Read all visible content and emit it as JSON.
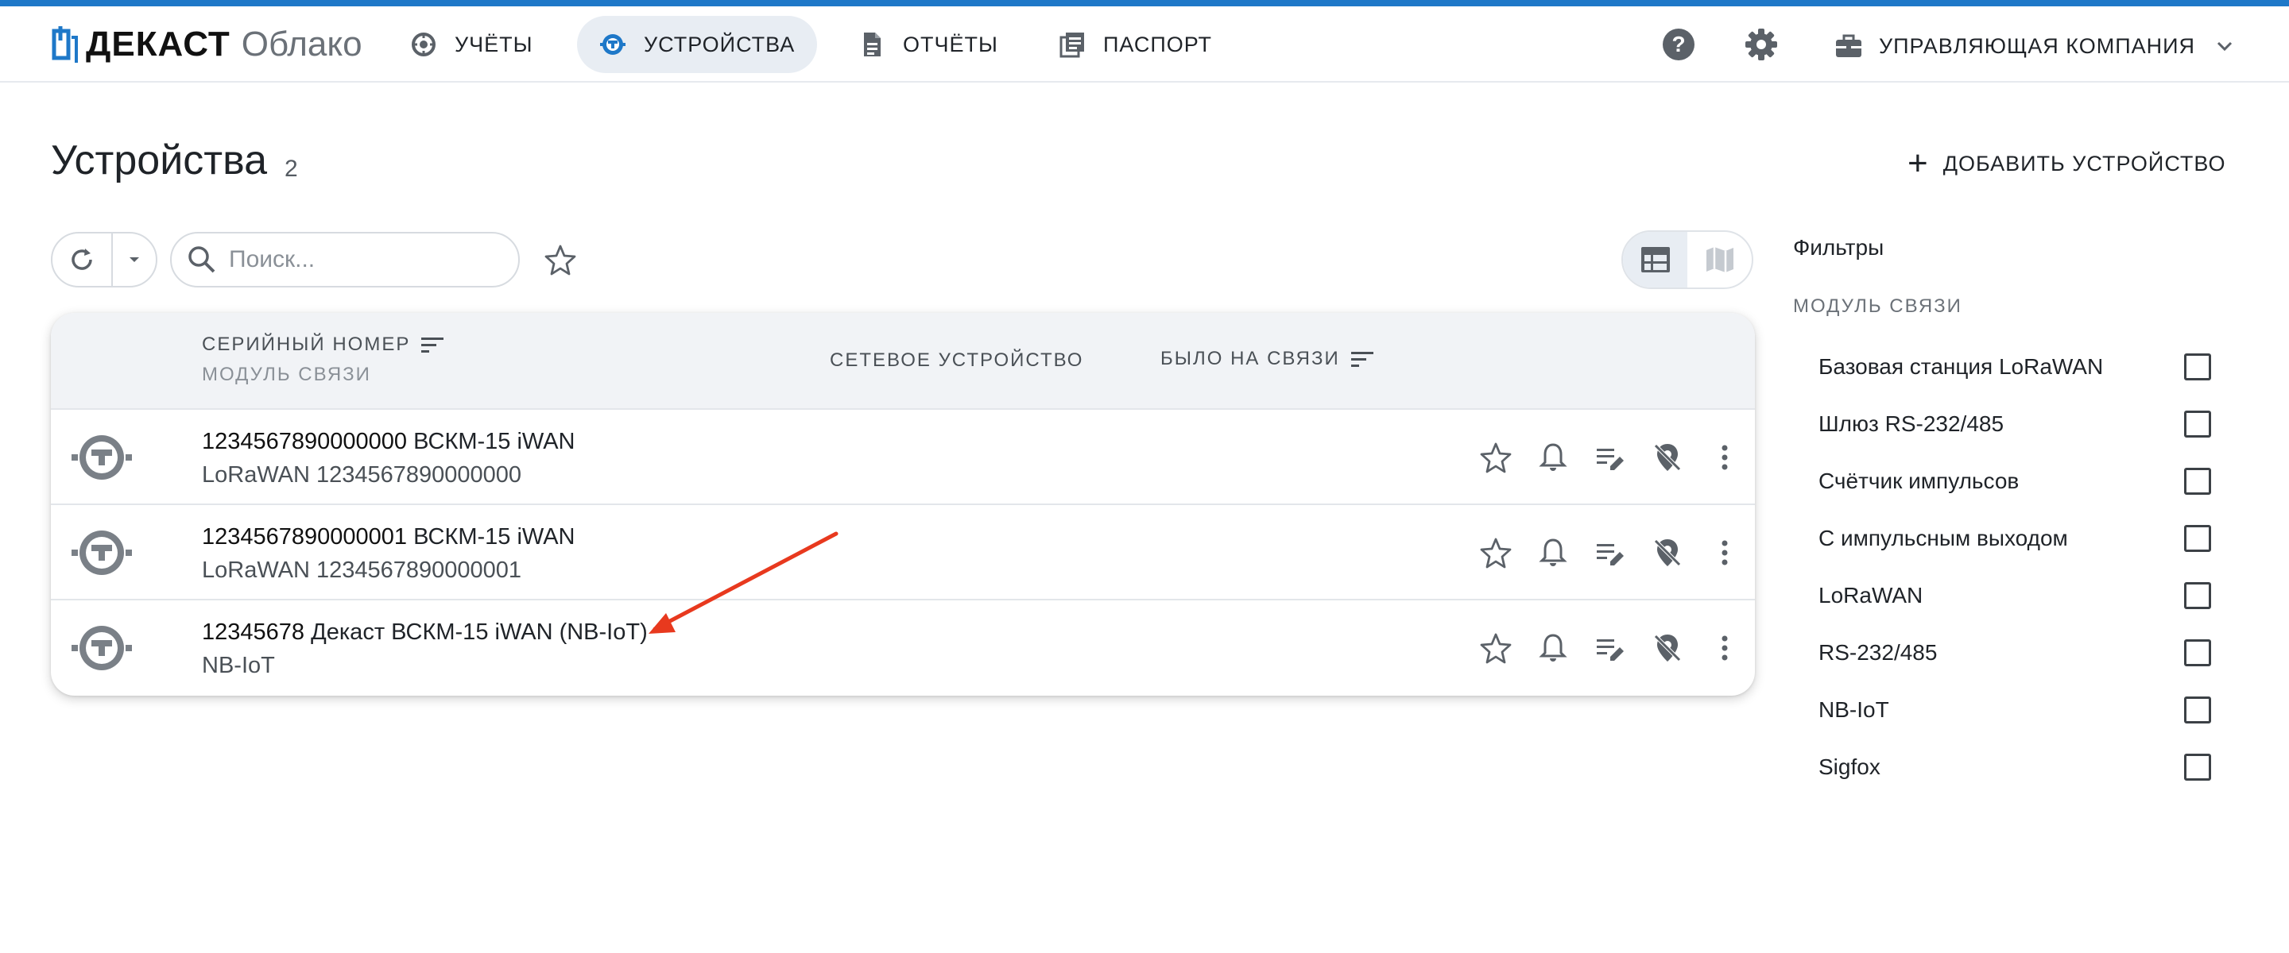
{
  "app": {
    "brand": "ДЕКАСТ",
    "brand_suffix": "Облако"
  },
  "nav": {
    "items": [
      {
        "label": "УЧЁТЫ",
        "icon": "counter-icon"
      },
      {
        "label": "УСТРОЙСТВА",
        "icon": "meter-icon",
        "active": true
      },
      {
        "label": "ОТЧЁТЫ",
        "icon": "document-icon"
      },
      {
        "label": "ПАСПОРТ",
        "icon": "passport-icon"
      }
    ]
  },
  "header": {
    "help_icon": "help-icon",
    "settings_icon": "gear-icon",
    "company_label": "УПРАВЛЯЮЩАЯ КОМПАНИЯ"
  },
  "page": {
    "title": "Устройства",
    "count": "2",
    "add_button": "ДОБАВИТЬ УСТРОЙСТВО"
  },
  "toolbar": {
    "search_placeholder": "Поиск...",
    "search_value": ""
  },
  "table": {
    "columns": {
      "serial": "СЕРИЙНЫЙ НОМЕР",
      "serial_sub": "МОДУЛЬ СВЯЗИ",
      "network": "СЕТЕВОЕ УСТРОЙСТВО",
      "last_seen": "БЫЛО НА СВЯЗИ"
    },
    "rows": [
      {
        "serial": "1234567890000000",
        "name": "ВСКМ-15 iWAN",
        "module": "LoRaWAN 1234567890000000"
      },
      {
        "serial": "1234567890000001",
        "name": "ВСКМ-15 iWAN",
        "module": "LoRaWAN 1234567890000001"
      },
      {
        "serial": "12345678",
        "name": "Декаст ВСКМ-15 iWAN (NB-IoT)",
        "module": "NB-IoT"
      }
    ]
  },
  "filters": {
    "title": "Фильтры",
    "subtitle": "МОДУЛЬ СВЯЗИ",
    "options": [
      {
        "label": "Базовая станция LoRaWAN",
        "checked": false
      },
      {
        "label": "Шлюз RS-232/485",
        "checked": false
      },
      {
        "label": "Счётчик импульсов",
        "checked": false
      },
      {
        "label": "С импульсным выходом",
        "checked": false
      },
      {
        "label": "LoRaWAN",
        "checked": false
      },
      {
        "label": "RS-232/485",
        "checked": false
      },
      {
        "label": "NB-IoT",
        "checked": false
      },
      {
        "label": "Sigfox",
        "checked": false
      }
    ]
  },
  "colors": {
    "accent": "#1e78c8",
    "annotation": "#e8391e",
    "active_bg": "#e8edf3"
  }
}
